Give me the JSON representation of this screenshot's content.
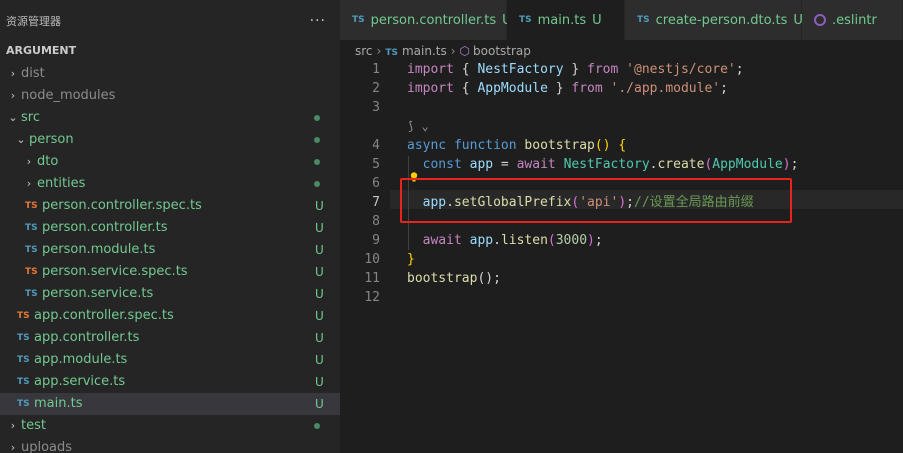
{
  "sidebar": {
    "title": "资源管理器",
    "more": "···",
    "section": "ARGUMENT",
    "items": [
      {
        "label": "dist",
        "kind": "folder",
        "depth": 0,
        "open": false,
        "color": "dim",
        "status": ""
      },
      {
        "label": "node_modules",
        "kind": "folder",
        "depth": 0,
        "open": false,
        "color": "dim",
        "status": ""
      },
      {
        "label": "src",
        "kind": "folder",
        "depth": 0,
        "open": true,
        "color": "git",
        "status": "dot"
      },
      {
        "label": "person",
        "kind": "folder",
        "depth": 1,
        "open": true,
        "color": "git",
        "status": "dot"
      },
      {
        "label": "dto",
        "kind": "folder",
        "depth": 2,
        "open": false,
        "color": "git",
        "status": "dot"
      },
      {
        "label": "entities",
        "kind": "folder",
        "depth": 2,
        "open": false,
        "color": "git",
        "status": "dot"
      },
      {
        "label": "person.controller.spec.ts",
        "kind": "ts",
        "tscolor": "orange",
        "depth": 2,
        "color": "git",
        "status": "U"
      },
      {
        "label": "person.controller.ts",
        "kind": "ts",
        "tscolor": "blue",
        "depth": 2,
        "color": "git",
        "status": "U"
      },
      {
        "label": "person.module.ts",
        "kind": "ts",
        "tscolor": "blue",
        "depth": 2,
        "color": "git",
        "status": "U"
      },
      {
        "label": "person.service.spec.ts",
        "kind": "ts",
        "tscolor": "orange",
        "depth": 2,
        "color": "git",
        "status": "U"
      },
      {
        "label": "person.service.ts",
        "kind": "ts",
        "tscolor": "blue",
        "depth": 2,
        "color": "git",
        "status": "U"
      },
      {
        "label": "app.controller.spec.ts",
        "kind": "ts",
        "tscolor": "orange",
        "depth": 1,
        "color": "git",
        "status": "U"
      },
      {
        "label": "app.controller.ts",
        "kind": "ts",
        "tscolor": "blue",
        "depth": 1,
        "color": "git",
        "status": "U"
      },
      {
        "label": "app.module.ts",
        "kind": "ts",
        "tscolor": "blue",
        "depth": 1,
        "color": "git",
        "status": "U"
      },
      {
        "label": "app.service.ts",
        "kind": "ts",
        "tscolor": "blue",
        "depth": 1,
        "color": "git",
        "status": "U"
      },
      {
        "label": "main.ts",
        "kind": "ts",
        "tscolor": "blue",
        "depth": 1,
        "color": "git",
        "status": "U",
        "selected": true
      },
      {
        "label": "test",
        "kind": "folder",
        "depth": 0,
        "open": false,
        "color": "git",
        "status": "dot"
      },
      {
        "label": "uploads",
        "kind": "folder",
        "depth": 0,
        "open": false,
        "color": "dim",
        "status": ""
      }
    ]
  },
  "tabs": [
    {
      "icon": "TS",
      "label": "person.controller.ts",
      "status": "U"
    },
    {
      "icon": "TS",
      "label": "main.ts",
      "status": "U",
      "active": true
    },
    {
      "icon": "TS",
      "label": "create-person.dto.ts",
      "status": "U"
    },
    {
      "icon": "eslint",
      "label": ".eslintr"
    }
  ],
  "breadcrumb": {
    "folder": "src",
    "file_icon": "TS",
    "file": "main.ts",
    "symbol": "bootstrap"
  },
  "code": {
    "line_numbers": [
      "1",
      "2",
      "3",
      "4",
      "5",
      "6",
      "7",
      "8",
      "9",
      "10",
      "11",
      "12"
    ],
    "current_line": "7",
    "lines": [
      [
        {
          "t": "import",
          "c": "kw"
        },
        {
          "t": " { ",
          "c": "pn"
        },
        {
          "t": "NestFactory",
          "c": "var"
        },
        {
          "t": " } ",
          "c": "pn"
        },
        {
          "t": "from",
          "c": "kw"
        },
        {
          "t": " ",
          "c": "pn"
        },
        {
          "t": "'@nestjs/core'",
          "c": "str"
        },
        {
          "t": ";",
          "c": "pn"
        }
      ],
      [
        {
          "t": "import",
          "c": "kw"
        },
        {
          "t": " { ",
          "c": "pn"
        },
        {
          "t": "AppModule",
          "c": "var"
        },
        {
          "t": " } ",
          "c": "pn"
        },
        {
          "t": "from",
          "c": "kw"
        },
        {
          "t": " ",
          "c": "pn"
        },
        {
          "t": "'./app.module'",
          "c": "str"
        },
        {
          "t": ";",
          "c": "pn"
        }
      ],
      [],
      [
        {
          "t": "async",
          "c": "kw2"
        },
        {
          "t": " ",
          "c": "pn"
        },
        {
          "t": "function",
          "c": "kw2"
        },
        {
          "t": " ",
          "c": "pn"
        },
        {
          "t": "bootstrap",
          "c": "fn"
        },
        {
          "t": "() {",
          "c": "p1"
        }
      ],
      [
        {
          "t": "  ",
          "c": "pn"
        },
        {
          "t": "const",
          "c": "kw2"
        },
        {
          "t": " ",
          "c": "pn"
        },
        {
          "t": "app",
          "c": "var"
        },
        {
          "t": " = ",
          "c": "pn"
        },
        {
          "t": "await",
          "c": "kw"
        },
        {
          "t": " ",
          "c": "pn"
        },
        {
          "t": "NestFactory",
          "c": "cls"
        },
        {
          "t": ".",
          "c": "pn"
        },
        {
          "t": "create",
          "c": "fn"
        },
        {
          "t": "(",
          "c": "p2"
        },
        {
          "t": "AppModule",
          "c": "cls"
        },
        {
          "t": ")",
          "c": "p2"
        },
        {
          "t": ";",
          "c": "pn"
        }
      ],
      [],
      [
        {
          "t": "  ",
          "c": "pn"
        },
        {
          "t": "app",
          "c": "var"
        },
        {
          "t": ".",
          "c": "pn"
        },
        {
          "t": "setGlobalPrefix",
          "c": "fn"
        },
        {
          "t": "(",
          "c": "p2"
        },
        {
          "t": "'api'",
          "c": "str"
        },
        {
          "t": ")",
          "c": "p2"
        },
        {
          "t": ";",
          "c": "pn"
        },
        {
          "t": "//设置全局路由前缀",
          "c": "cm"
        }
      ],
      [],
      [
        {
          "t": "  ",
          "c": "pn"
        },
        {
          "t": "await",
          "c": "kw"
        },
        {
          "t": " ",
          "c": "pn"
        },
        {
          "t": "app",
          "c": "var"
        },
        {
          "t": ".",
          "c": "pn"
        },
        {
          "t": "listen",
          "c": "fn"
        },
        {
          "t": "(",
          "c": "p2"
        },
        {
          "t": "3000",
          "c": "num"
        },
        {
          "t": ")",
          "c": "p2"
        },
        {
          "t": ";",
          "c": "pn"
        }
      ],
      [
        {
          "t": "}",
          "c": "p1"
        }
      ],
      [
        {
          "t": "bootstrap",
          "c": "fn"
        },
        {
          "t": "();",
          "c": "pn"
        }
      ],
      []
    ]
  }
}
